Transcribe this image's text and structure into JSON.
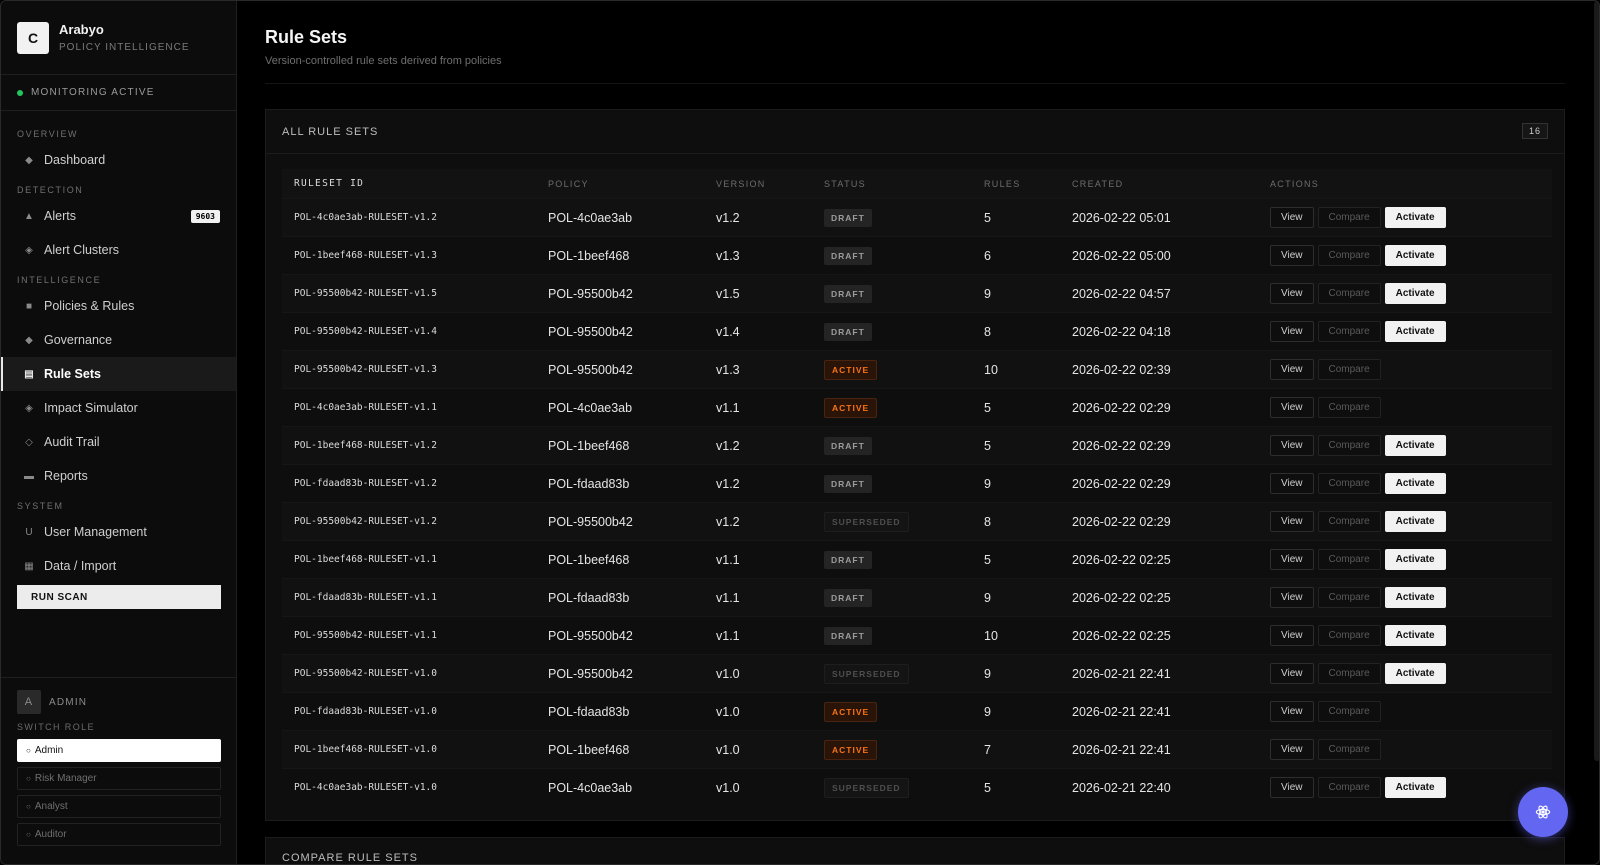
{
  "brand": {
    "logo_letter": "C",
    "name": "Arabyo",
    "subtitle": "POLICY INTELLIGENCE"
  },
  "monitoring": {
    "label": "MONITORING ACTIVE",
    "color": "#22c55e"
  },
  "sidebar": {
    "sections": {
      "overview": "OVERVIEW",
      "detection": "DETECTION",
      "intelligence": "INTELLIGENCE",
      "system": "SYSTEM"
    },
    "items": {
      "dashboard": "Dashboard",
      "alerts": "Alerts",
      "alerts_badge": "9603",
      "alert_clusters": "Alert Clusters",
      "policies": "Policies & Rules",
      "governance": "Governance",
      "rule_sets": "Rule Sets",
      "impact": "Impact Simulator",
      "audit": "Audit Trail",
      "reports": "Reports",
      "users": "User Management",
      "data_import": "Data / Import"
    },
    "run_scan": "RUN SCAN"
  },
  "user": {
    "avatar": "A",
    "role": "ADMIN",
    "switch_label": "SWITCH ROLE",
    "roles": [
      "Admin",
      "Risk Manager",
      "Analyst",
      "Auditor"
    ],
    "role_marker": "○"
  },
  "page": {
    "title": "Rule Sets",
    "subtitle": "Version-controlled rule sets derived from policies"
  },
  "table_card": {
    "title": "ALL RULE SETS",
    "count": "16"
  },
  "table": {
    "headers": [
      "RULESET ID",
      "POLICY",
      "VERSION",
      "STATUS",
      "RULES",
      "CREATED",
      "ACTIONS"
    ],
    "action_labels": {
      "view": "View",
      "compare": "Compare",
      "activate": "Activate"
    },
    "rows": [
      {
        "id": "POL-4c0ae3ab-RULESET-v1.2",
        "policy": "POL-4c0ae3ab",
        "version": "v1.2",
        "status": "DRAFT",
        "rules": "5",
        "created": "2026-02-22 05:01",
        "activate": true
      },
      {
        "id": "POL-1beef468-RULESET-v1.3",
        "policy": "POL-1beef468",
        "version": "v1.3",
        "status": "DRAFT",
        "rules": "6",
        "created": "2026-02-22 05:00",
        "activate": true
      },
      {
        "id": "POL-95500b42-RULESET-v1.5",
        "policy": "POL-95500b42",
        "version": "v1.5",
        "status": "DRAFT",
        "rules": "9",
        "created": "2026-02-22 04:57",
        "activate": true
      },
      {
        "id": "POL-95500b42-RULESET-v1.4",
        "policy": "POL-95500b42",
        "version": "v1.4",
        "status": "DRAFT",
        "rules": "8",
        "created": "2026-02-22 04:18",
        "activate": true
      },
      {
        "id": "POL-95500b42-RULESET-v1.3",
        "policy": "POL-95500b42",
        "version": "v1.3",
        "status": "ACTIVE",
        "rules": "10",
        "created": "2026-02-22 02:39",
        "activate": false
      },
      {
        "id": "POL-4c0ae3ab-RULESET-v1.1",
        "policy": "POL-4c0ae3ab",
        "version": "v1.1",
        "status": "ACTIVE",
        "rules": "5",
        "created": "2026-02-22 02:29",
        "activate": false
      },
      {
        "id": "POL-1beef468-RULESET-v1.2",
        "policy": "POL-1beef468",
        "version": "v1.2",
        "status": "DRAFT",
        "rules": "5",
        "created": "2026-02-22 02:29",
        "activate": true
      },
      {
        "id": "POL-fdaad83b-RULESET-v1.2",
        "policy": "POL-fdaad83b",
        "version": "v1.2",
        "status": "DRAFT",
        "rules": "9",
        "created": "2026-02-22 02:29",
        "activate": true
      },
      {
        "id": "POL-95500b42-RULESET-v1.2",
        "policy": "POL-95500b42",
        "version": "v1.2",
        "status": "SUPERSEDED",
        "rules": "8",
        "created": "2026-02-22 02:29",
        "activate": true
      },
      {
        "id": "POL-1beef468-RULESET-v1.1",
        "policy": "POL-1beef468",
        "version": "v1.1",
        "status": "DRAFT",
        "rules": "5",
        "created": "2026-02-22 02:25",
        "activate": true
      },
      {
        "id": "POL-fdaad83b-RULESET-v1.1",
        "policy": "POL-fdaad83b",
        "version": "v1.1",
        "status": "DRAFT",
        "rules": "9",
        "created": "2026-02-22 02:25",
        "activate": true
      },
      {
        "id": "POL-95500b42-RULESET-v1.1",
        "policy": "POL-95500b42",
        "version": "v1.1",
        "status": "DRAFT",
        "rules": "10",
        "created": "2026-02-22 02:25",
        "activate": true
      },
      {
        "id": "POL-95500b42-RULESET-v1.0",
        "policy": "POL-95500b42",
        "version": "v1.0",
        "status": "SUPERSEDED",
        "rules": "9",
        "created": "2026-02-21 22:41",
        "activate": true
      },
      {
        "id": "POL-fdaad83b-RULESET-v1.0",
        "policy": "POL-fdaad83b",
        "version": "v1.0",
        "status": "ACTIVE",
        "rules": "9",
        "created": "2026-02-21 22:41",
        "activate": false
      },
      {
        "id": "POL-1beef468-RULESET-v1.0",
        "policy": "POL-1beef468",
        "version": "v1.0",
        "status": "ACTIVE",
        "rules": "7",
        "created": "2026-02-21 22:41",
        "activate": false
      },
      {
        "id": "POL-4c0ae3ab-RULESET-v1.0",
        "policy": "POL-4c0ae3ab",
        "version": "v1.0",
        "status": "SUPERSEDED",
        "rules": "5",
        "created": "2026-02-21 22:40",
        "activate": true
      }
    ]
  },
  "compare_card": {
    "title": "COMPARE RULE SETS"
  },
  "colors": {
    "accent_fab": "#6366f1",
    "status_active": "#f97316"
  },
  "icons": {
    "fab": "assistant-icon"
  }
}
